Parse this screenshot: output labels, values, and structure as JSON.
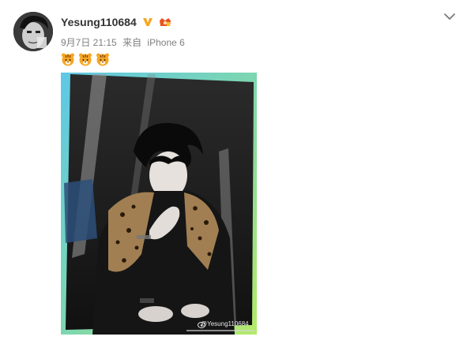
{
  "post": {
    "username": "Yesung110684",
    "timestamp": "9月7日 21:15",
    "source_prefix": "来自",
    "source_device": "iPhone 6",
    "emojis": [
      "tiger-face",
      "tiger-face",
      "tiger-face"
    ],
    "watermark": "@Yesung110684",
    "icons": {
      "verified": "verified-v-icon",
      "member": "member-crown-icon",
      "menu": "chevron-down-icon"
    },
    "colors": {
      "verified": "#f5a623",
      "member": "#e8541e",
      "frame_green": "#9ee37a",
      "frame_cyan": "#5ec8e6",
      "meta_text": "#808080"
    }
  }
}
